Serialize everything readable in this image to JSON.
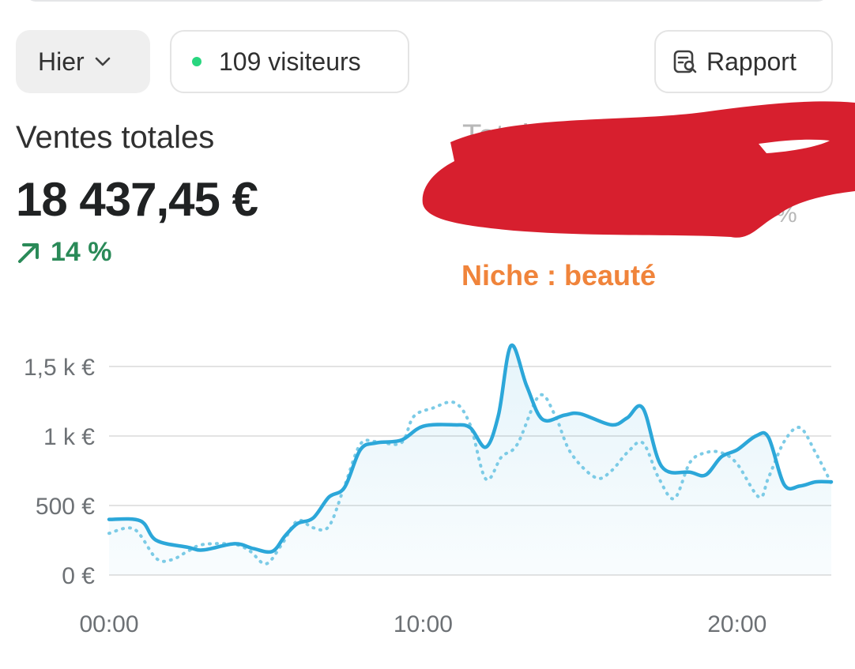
{
  "toolbar": {
    "date_label": "Hier",
    "visitors_label": "109 visiteurs",
    "report_label": "Rapport"
  },
  "metrics": {
    "sales_label": "Ventes totales",
    "sales_value": "18 437,45 €",
    "sales_change": "14 %",
    "second_metric_partial_label": "Total",
    "second_metric_partial_percent": "%"
  },
  "annotation": {
    "niche_text": "Niche : beauté"
  },
  "colors": {
    "current_line": "#2ca7d9",
    "previous_line": "#7ccbe6",
    "increase": "#2a8a58",
    "annotation": "#f0843b",
    "status_dot": "#29d67f",
    "redaction": "#d71f2e"
  },
  "icons": {
    "date_dropdown": "chevron-down-icon",
    "visitors_status": "status-dot-icon",
    "report": "report-search-icon",
    "change_direction": "arrow-up-right-icon"
  },
  "chart_data": {
    "type": "line",
    "x_ticks": [
      "00:00",
      "10:00",
      "20:00"
    ],
    "y_ticks": [
      "0 €",
      "500 €",
      "1 k €",
      "1,5 k €"
    ],
    "ylim": [
      0,
      1750
    ],
    "xlim": [
      0,
      23
    ],
    "grid": true,
    "series": [
      {
        "role": "current",
        "style": "solid",
        "points": [
          [
            0,
            400
          ],
          [
            1,
            390
          ],
          [
            1.5,
            250
          ],
          [
            2.5,
            200
          ],
          [
            3,
            180
          ],
          [
            4,
            225
          ],
          [
            4.6,
            190
          ],
          [
            5.2,
            170
          ],
          [
            5.6,
            280
          ],
          [
            6,
            370
          ],
          [
            6.5,
            410
          ],
          [
            7,
            560
          ],
          [
            7.5,
            630
          ],
          [
            8,
            900
          ],
          [
            8.5,
            950
          ],
          [
            9.3,
            970
          ],
          [
            10,
            1070
          ],
          [
            11,
            1080
          ],
          [
            11.5,
            1060
          ],
          [
            12,
            920
          ],
          [
            12.4,
            1150
          ],
          [
            12.8,
            1650
          ],
          [
            13.3,
            1360
          ],
          [
            13.8,
            1120
          ],
          [
            14.5,
            1150
          ],
          [
            15,
            1160
          ],
          [
            16,
            1080
          ],
          [
            16.5,
            1130
          ],
          [
            17,
            1200
          ],
          [
            17.6,
            780
          ],
          [
            18.5,
            740
          ],
          [
            19,
            720
          ],
          [
            19.5,
            850
          ],
          [
            20,
            900
          ],
          [
            20.6,
            1000
          ],
          [
            21,
            990
          ],
          [
            21.5,
            650
          ],
          [
            22,
            640
          ],
          [
            22.5,
            670
          ],
          [
            23,
            670
          ]
        ]
      },
      {
        "role": "previous",
        "style": "dotted",
        "points": [
          [
            0,
            300
          ],
          [
            0.8,
            330
          ],
          [
            1.5,
            120
          ],
          [
            2,
            110
          ],
          [
            2.5,
            170
          ],
          [
            3,
            220
          ],
          [
            4,
            220
          ],
          [
            4.5,
            170
          ],
          [
            5,
            80
          ],
          [
            5.5,
            220
          ],
          [
            6,
            390
          ],
          [
            6.5,
            340
          ],
          [
            7,
            350
          ],
          [
            7.5,
            640
          ],
          [
            8,
            940
          ],
          [
            8.5,
            960
          ],
          [
            9.3,
            950
          ],
          [
            9.7,
            1140
          ],
          [
            10.3,
            1200
          ],
          [
            11,
            1240
          ],
          [
            11.5,
            1080
          ],
          [
            12,
            690
          ],
          [
            12.5,
            850
          ],
          [
            13,
            940
          ],
          [
            13.7,
            1290
          ],
          [
            14.2,
            1150
          ],
          [
            14.7,
            880
          ],
          [
            15.5,
            700
          ],
          [
            16,
            750
          ],
          [
            16.5,
            880
          ],
          [
            17,
            950
          ],
          [
            17.5,
            700
          ],
          [
            18,
            550
          ],
          [
            18.5,
            810
          ],
          [
            19,
            880
          ],
          [
            19.5,
            880
          ],
          [
            20,
            800
          ],
          [
            20.7,
            560
          ],
          [
            21,
            700
          ],
          [
            21.5,
            960
          ],
          [
            22,
            1060
          ],
          [
            22.5,
            880
          ],
          [
            23,
            660
          ]
        ]
      }
    ]
  }
}
